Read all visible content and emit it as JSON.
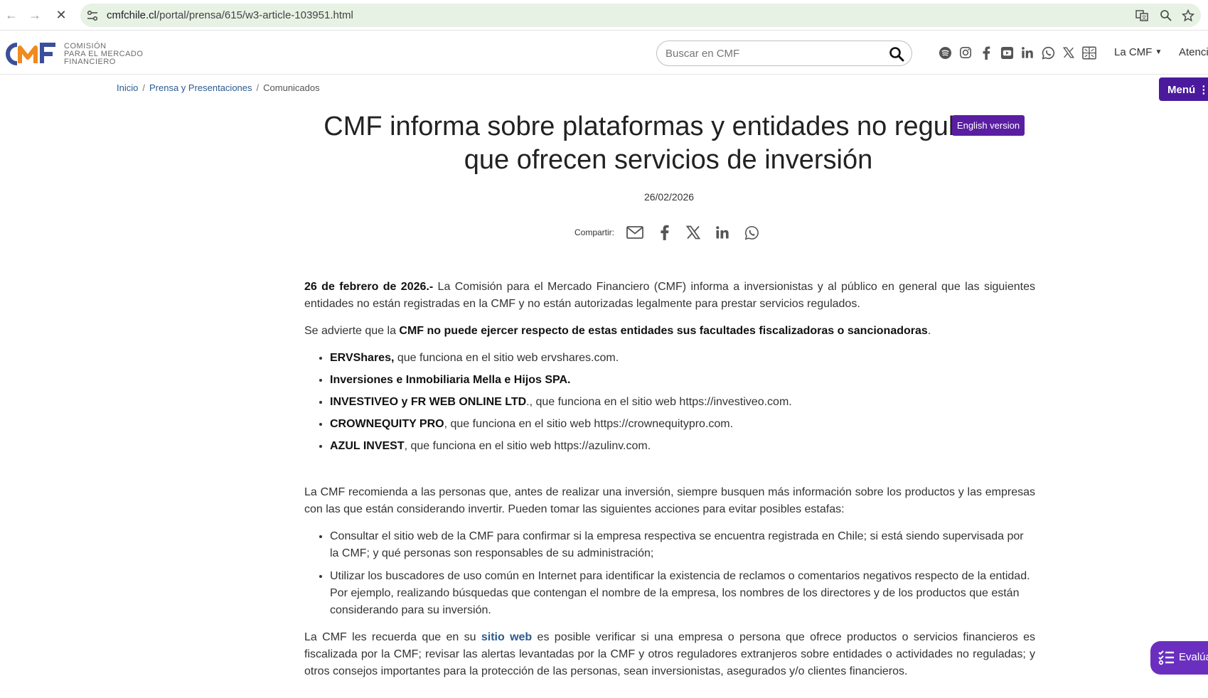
{
  "browser": {
    "url_host": "cmfchile.cl",
    "url_path": "/portal/prensa/615/w3-article-103951.html"
  },
  "header": {
    "logo_lines": [
      "COMISIÓN",
      "PARA EL MERCADO",
      "FINANCIERO"
    ],
    "search_placeholder": "Buscar en CMF",
    "social_icons": [
      "spotify-icon",
      "instagram-icon",
      "facebook-icon",
      "youtube-icon",
      "linkedin-icon",
      "whatsapp-icon",
      "x-icon",
      "flickr-icon"
    ],
    "nav_la_cmf": "La CMF",
    "nav_atencion": "Atenci"
  },
  "breadcrumb": {
    "items": [
      "Inicio",
      "Prensa y Presentaciones",
      "Comunicados"
    ],
    "separator": "/"
  },
  "menu_label": "Menú",
  "article": {
    "title": "CMF informa sobre plataformas y entidades no reguladas que ofrecen servicios de inversión",
    "english_label": "English version",
    "date": "26/02/2026",
    "share_label": "Compartir:",
    "p1_lead": "26 de febrero de 2026.-",
    "p1_text": " La Comisión para el Mercado Financiero (CMF) informa a inversionistas y al público en general que las siguientes entidades no están registradas en la CMF y no están autorizadas legalmente para prestar servicios regulados.",
    "p2_pre": "Se advierte que la ",
    "p2_bold": "CMF no puede ejercer respecto de estas entidades sus facultades fiscalizadoras o sancionadoras",
    "p2_post": ".",
    "entities": [
      {
        "name": "ERVShares,",
        "desc": " que funciona en el sitio web ervshares.com."
      },
      {
        "name": "Inversiones e Inmobiliaria Mella e Hijos SPA.",
        "desc": ""
      },
      {
        "name": "INVESTIVEO y FR WEB ONLINE LTD",
        "desc": "., que funciona en el sitio web https://investiveo.com."
      },
      {
        "name": "CROWNEQUITY PRO",
        "desc": ", que funciona en el sitio web https://crownequitypro.com."
      },
      {
        "name": "AZUL INVEST",
        "desc": ", que funciona en el sitio web https://azulinv.com."
      }
    ],
    "p3": "La CMF recomienda a las personas que, antes de realizar una inversión, siempre busquen más información sobre los productos y las empresas con las que están considerando invertir. Pueden tomar las siguientes acciones para evitar posibles estafas:",
    "tips": [
      "Consultar el sitio web de la CMF para confirmar si la empresa respectiva se encuentra registrada en Chile; si está siendo supervisada por la CMF; y qué personas son responsables de su administración;",
      "Utilizar los buscadores de uso común en Internet para identificar la existencia de reclamos o comentarios negativos respecto de la entidad. Por ejemplo, realizando búsquedas que contengan el nombre de la empresa, los nombres de los directores y de los productos que están considerando para su inversión."
    ],
    "p4_pre": "La CMF les recuerda que en su ",
    "p4_link": "sitio web",
    "p4_post": " es posible verificar si una empresa o persona que ofrece productos o servicios financieros es fiscalizada por la CMF; revisar las alertas levantadas por la CMF y otros reguladores extranjeros sobre entidades o actividades no reguladas; y otros consejos importantes para la protección de las personas, sean inversionistas, asegurados y/o clientes financieros."
  },
  "eval_label": "Evalúa",
  "colors": {
    "accent_purple": "#5a1ea2",
    "link_blue": "#2b5a8f",
    "logo_blue": "#3b4f9a",
    "logo_orange": "#f08a1c"
  }
}
